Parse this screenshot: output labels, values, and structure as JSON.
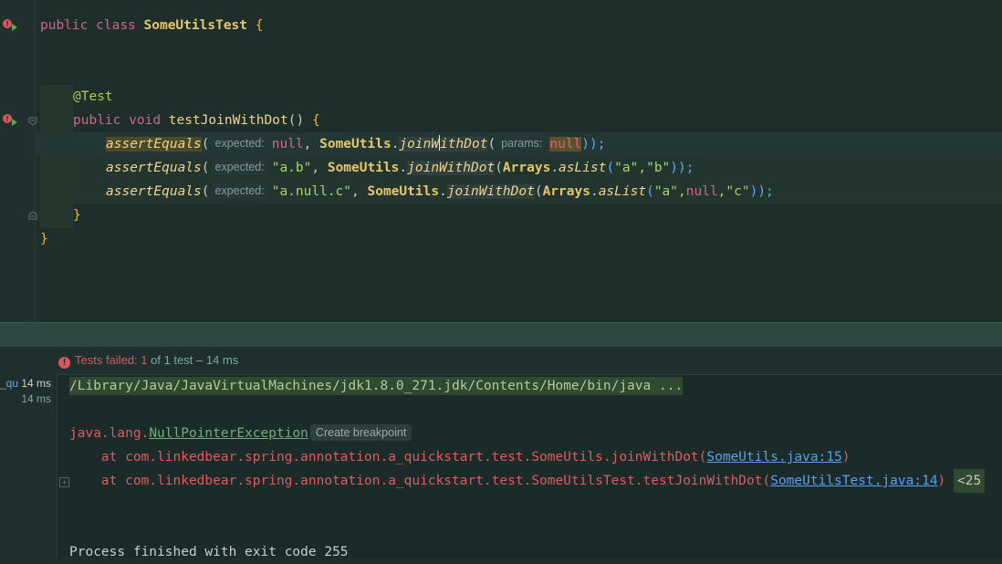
{
  "editor": {
    "line1": {
      "kw_public": "public",
      "kw_class": "class",
      "class_name": "SomeUtilsTest",
      "open_brace": "{"
    },
    "line2": {
      "annotation": "@Test"
    },
    "line3": {
      "kw_public": "public",
      "kw_void": "void",
      "method_name": "testJoinWithDot",
      "parens": "()",
      "open_brace": "{"
    },
    "line4": {
      "call": "assertEquals",
      "open": "(",
      "hint_expected": "expected:",
      "expected_value": "null",
      "comma": ",",
      "class_ref": "SomeUtils",
      "dot": ".",
      "method_before_caret": "joinW",
      "method_after_caret": "ithDot",
      "open2": "(",
      "hint_params": "params:",
      "param_value": "null",
      "close": "));"
    },
    "line5": {
      "call": "assertEquals",
      "open": "(",
      "hint_expected": "expected:",
      "expected_value": "\"a.b\"",
      "comma": ",",
      "class_ref": "SomeUtils",
      "dot": ".",
      "method": "joinWithDot",
      "open2": "(",
      "arrays": "Arrays",
      "dot2": ".",
      "aslist": "asList",
      "open3": "(",
      "args": "\"a\",\"b\"",
      "close": "));"
    },
    "line6": {
      "call": "assertEquals",
      "open": "(",
      "hint_expected": "expected:",
      "expected_value": "\"a.null.c\"",
      "comma": ",",
      "class_ref": "SomeUtils",
      "dot": ".",
      "method": "joinWithDot",
      "open2": "(",
      "arrays": "Arrays",
      "dot2": ".",
      "aslist": "asList",
      "open3": "(",
      "arg1": "\"a\",",
      "arg2": "null",
      "arg3": ",\"c\"",
      "close": "));"
    },
    "line7": {
      "close_brace": "}"
    },
    "line8": {
      "close_brace": "}"
    }
  },
  "test_panel": {
    "status": {
      "label": "Tests failed:",
      "count": "1",
      "detail": "of 1 test – 14 ms"
    },
    "tree": [
      {
        "name": "_qu",
        "time": "14 ms"
      },
      {
        "name": "",
        "time": "14 ms"
      }
    ],
    "console": {
      "command": "/Library/Java/JavaVirtualMachines/jdk1.8.0_271.jdk/Contents/Home/bin/java ...",
      "exception_prefix": "java.lang.",
      "exception_name": "NullPointerException",
      "breakpoint_button": "Create breakpoint",
      "trace1_prefix": "    at com.linkedbear.spring.annotation.a_quickstart.test.SomeUtils.joinWithDot(",
      "trace1_link": "SomeUtils.java:15",
      "trace1_suffix": ")",
      "trace2_prefix": "    at com.linkedbear.spring.annotation.a_quickstart.test.SomeUtilsTest.testJoinWithDot(",
      "trace2_link": "SomeUtilsTest.java:14",
      "trace2_suffix": ")",
      "trace2_more": "<25",
      "exit_message": "Process finished with exit code 255"
    }
  },
  "colors": {
    "error": "#e05a5e",
    "link": "#5aa0f0",
    "background": "#1d2e2b"
  }
}
